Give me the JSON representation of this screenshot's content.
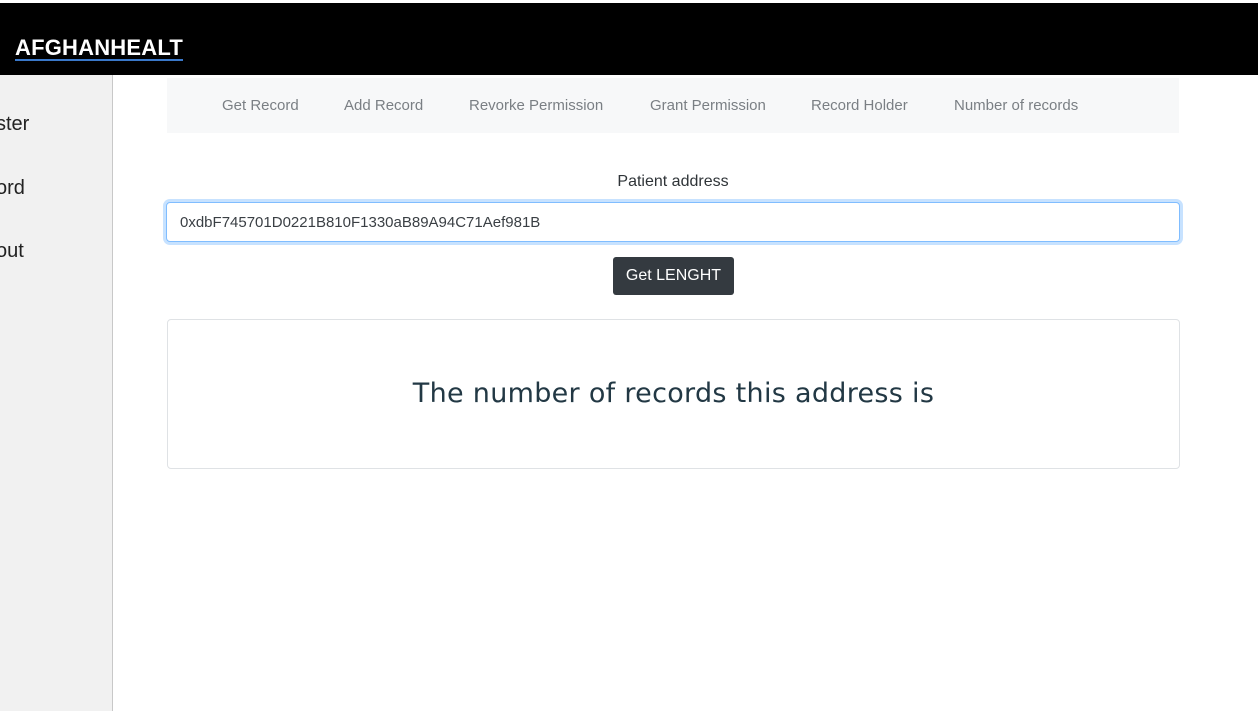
{
  "header": {
    "brand": "AFGHANHEALT"
  },
  "sidebar": {
    "items": [
      {
        "label": "ster"
      },
      {
        "label": "ord"
      },
      {
        "label": "out"
      }
    ]
  },
  "subnav": {
    "items": [
      {
        "label": "Get Record"
      },
      {
        "label": "Add Record"
      },
      {
        "label": "Revorke Permission"
      },
      {
        "label": "Grant Permission"
      },
      {
        "label": "Record Holder"
      },
      {
        "label": "Number of records"
      }
    ]
  },
  "form": {
    "label": "Patient address",
    "address_value": "0xdbF745701D0221B810F1330aB89A94C71Aef981B",
    "button_label": "Get LENGHT"
  },
  "result": {
    "text": "The number of records this address is"
  },
  "colors": {
    "topbar": "#000000",
    "button": "#343a40",
    "input_focus": "#80bdff",
    "subnav_bg": "#f7f8f9",
    "sidebar_bg": "#f1f1f1"
  }
}
